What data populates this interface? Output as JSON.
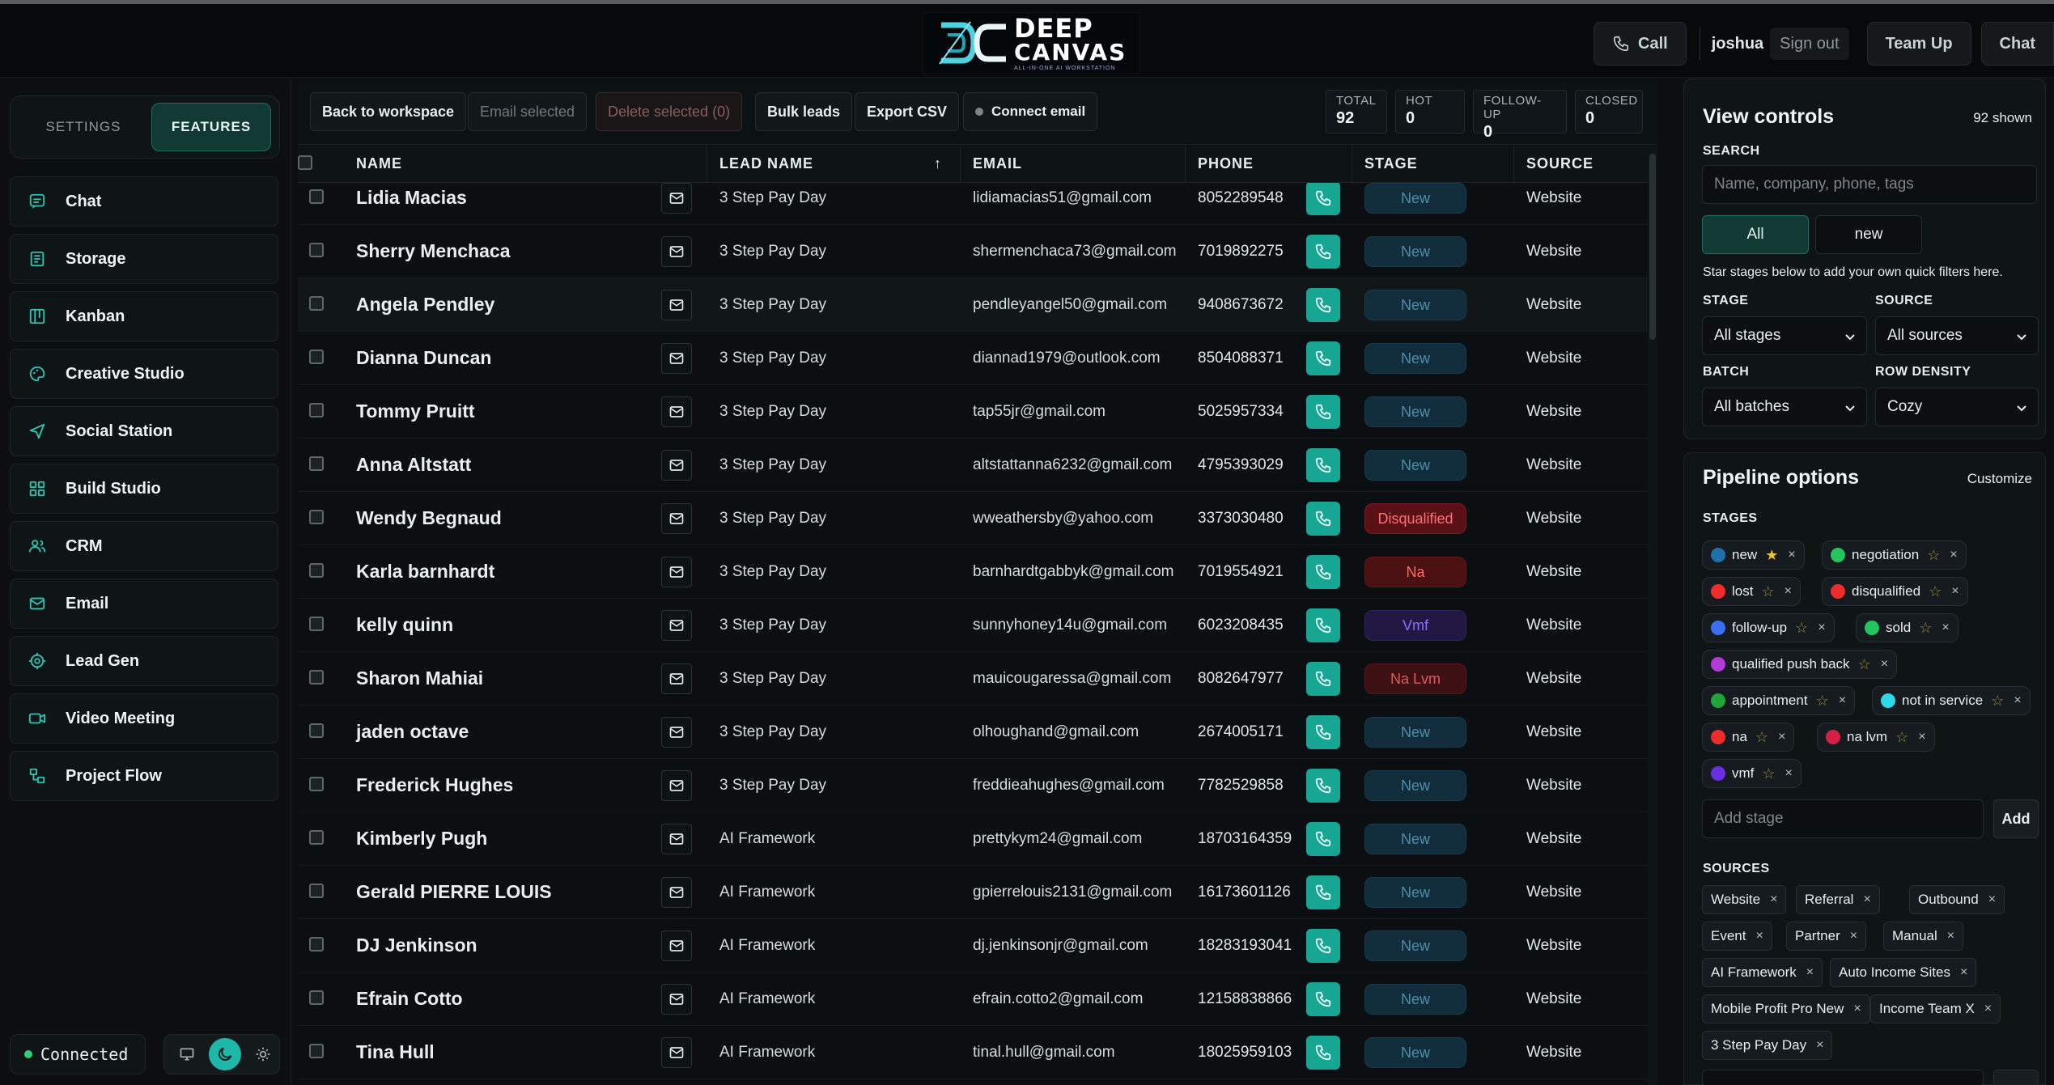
{
  "header": {
    "logo": {
      "line1": "DEEP",
      "line2": "CANVAS",
      "tagline": "ALL-IN-ONE AI WORKSTATION"
    },
    "call_label": "Call",
    "user": "joshua",
    "sign_out_label": "Sign out",
    "team_up_label": "Team Up",
    "chat_label": "Chat"
  },
  "sidebar": {
    "tabs": {
      "settings": "SETTINGS",
      "features": "FEATURES",
      "active": "features"
    },
    "items": [
      {
        "label": "Chat",
        "icon": "chat-icon"
      },
      {
        "label": "Storage",
        "icon": "storage-icon"
      },
      {
        "label": "Kanban",
        "icon": "kanban-icon"
      },
      {
        "label": "Creative Studio",
        "icon": "palette-icon"
      },
      {
        "label": "Social Station",
        "icon": "send-icon"
      },
      {
        "label": "Build Studio",
        "icon": "grid-icon"
      },
      {
        "label": "CRM",
        "icon": "users-icon"
      },
      {
        "label": "Email",
        "icon": "mail-icon"
      },
      {
        "label": "Lead Gen",
        "icon": "target-icon"
      },
      {
        "label": "Video Meeting",
        "icon": "video-icon"
      },
      {
        "label": "Project Flow",
        "icon": "flow-icon"
      }
    ],
    "status": "Connected",
    "theme_active": "dark"
  },
  "toolbar": {
    "back_label": "Back to workspace",
    "email_selected_label": "Email selected",
    "delete_selected_label": "Delete selected (0)",
    "bulk_leads_label": "Bulk leads",
    "export_csv_label": "Export CSV",
    "connect_email_label": "Connect email"
  },
  "stats": [
    {
      "label": "TOTAL",
      "value": "92"
    },
    {
      "label": "HOT",
      "value": "0"
    },
    {
      "label": "FOLLOW-UP",
      "value": "0"
    },
    {
      "label": "CLOSED",
      "value": "0"
    }
  ],
  "table": {
    "columns": {
      "name": "NAME",
      "lead_name": "LEAD NAME",
      "sort_indicator": "↑",
      "email": "EMAIL",
      "phone": "PHONE",
      "stage": "STAGE",
      "source": "SOURCE"
    },
    "rows": [
      {
        "name": "Lidia Macias",
        "lead": "3 Step Pay Day",
        "email": "lidiamacias51@gmail.com",
        "phone": "8052289548",
        "stage": "New",
        "stage_style": "new",
        "source": "Website"
      },
      {
        "name": "Sherry Menchaca",
        "lead": "3 Step Pay Day",
        "email": "shermenchaca73@gmail.com",
        "phone": "7019892275",
        "stage": "New",
        "stage_style": "new",
        "source": "Website"
      },
      {
        "name": "Angela Pendley",
        "lead": "3 Step Pay Day",
        "email": "pendleyangel50@gmail.com",
        "phone": "9408673672",
        "stage": "New",
        "stage_style": "new",
        "source": "Website"
      },
      {
        "name": "Dianna Duncan",
        "lead": "3 Step Pay Day",
        "email": "diannad1979@outlook.com",
        "phone": "8504088371",
        "stage": "New",
        "stage_style": "new",
        "source": "Website"
      },
      {
        "name": "Tommy Pruitt",
        "lead": "3 Step Pay Day",
        "email": "tap55jr@gmail.com",
        "phone": "5025957334",
        "stage": "New",
        "stage_style": "new",
        "source": "Website"
      },
      {
        "name": "Anna Altstatt",
        "lead": "3 Step Pay Day",
        "email": "altstattanna6232@gmail.com",
        "phone": "4795393029",
        "stage": "New",
        "stage_style": "new",
        "source": "Website"
      },
      {
        "name": "Wendy Begnaud",
        "lead": "3 Step Pay Day",
        "email": "wweathersby@yahoo.com",
        "phone": "3373030480",
        "stage": "Disqualified",
        "stage_style": "dis",
        "source": "Website"
      },
      {
        "name": "Karla barnhardt",
        "lead": "3 Step Pay Day",
        "email": "barnhardtgabbyk@gmail.com",
        "phone": "7019554921",
        "stage": "Na",
        "stage_style": "na",
        "source": "Website"
      },
      {
        "name": "kelly quinn",
        "lead": "3 Step Pay Day",
        "email": "sunnyhoney14u@gmail.com",
        "phone": "6023208435",
        "stage": "Vmf",
        "stage_style": "vmf",
        "source": "Website"
      },
      {
        "name": "Sharon Mahiai",
        "lead": "3 Step Pay Day",
        "email": "mauicougaressa@gmail.com",
        "phone": "8082647977",
        "stage": "Na Lvm",
        "stage_style": "nalvm",
        "source": "Website"
      },
      {
        "name": "jaden octave",
        "lead": "3 Step Pay Day",
        "email": "olhoughand@gmail.com",
        "phone": "2674005171",
        "stage": "New",
        "stage_style": "new",
        "source": "Website"
      },
      {
        "name": "Frederick Hughes",
        "lead": "3 Step Pay Day",
        "email": "freddieahughes@gmail.com",
        "phone": "7782529858",
        "stage": "New",
        "stage_style": "new",
        "source": "Website"
      },
      {
        "name": "Kimberly Pugh",
        "lead": "AI Framework",
        "email": "prettykym24@gmail.com",
        "phone": "18703164359",
        "stage": "New",
        "stage_style": "new",
        "source": "Website"
      },
      {
        "name": "Gerald PIERRE LOUIS",
        "lead": "AI Framework",
        "email": "gpierrelouis2131@gmail.com",
        "phone": "16173601126",
        "stage": "New",
        "stage_style": "new",
        "source": "Website"
      },
      {
        "name": "DJ Jenkinson",
        "lead": "AI Framework",
        "email": "dj.jenkinsonjr@gmail.com",
        "phone": "18283193041",
        "stage": "New",
        "stage_style": "new",
        "source": "Website"
      },
      {
        "name": "Efrain Cotto",
        "lead": "AI Framework",
        "email": "efrain.cotto2@gmail.com",
        "phone": "12158838866",
        "stage": "New",
        "stage_style": "new",
        "source": "Website"
      },
      {
        "name": "Tina Hull",
        "lead": "AI Framework",
        "email": "tinal.hull@gmail.com",
        "phone": "18025959103",
        "stage": "New",
        "stage_style": "new",
        "source": "Website"
      }
    ]
  },
  "view_controls": {
    "title": "View controls",
    "shown": "92 shown",
    "search_label": "SEARCH",
    "search_placeholder": "Name, company, phone, tags",
    "quick_filters": [
      "All",
      "new"
    ],
    "hint": "Star stages below to add your own quick filters here.",
    "stage_label": "STAGE",
    "stage_value": "All stages",
    "source_label": "SOURCE",
    "source_value": "All sources",
    "batch_label": "BATCH",
    "batch_value": "All batches",
    "density_label": "ROW DENSITY",
    "density_value": "Cozy"
  },
  "pipeline": {
    "title": "Pipeline options",
    "customize_label": "Customize",
    "stages_label": "STAGES",
    "stages": [
      {
        "label": "new",
        "color": "#1f6fa8",
        "starred": true
      },
      {
        "label": "negotiation",
        "color": "#22c55e",
        "starred": false
      },
      {
        "label": "lost",
        "color": "#ef2b2b",
        "starred": false
      },
      {
        "label": "disqualified",
        "color": "#ef2b2b",
        "starred": false
      },
      {
        "label": "follow-up",
        "color": "#3b6ff5",
        "starred": false
      },
      {
        "label": "sold",
        "color": "#22c55e",
        "starred": false
      },
      {
        "label": "qualified push back",
        "color": "#b23ad6",
        "starred": false
      },
      {
        "label": "appointment",
        "color": "#1fa53a",
        "starred": false
      },
      {
        "label": "not in service",
        "color": "#2bd9e8",
        "starred": false
      },
      {
        "label": "na",
        "color": "#ef2b2b",
        "starred": false
      },
      {
        "label": "na lvm",
        "color": "#d61f45",
        "starred": false
      },
      {
        "label": "vmf",
        "color": "#6a2fe0",
        "starred": false
      }
    ],
    "add_stage_placeholder": "Add stage",
    "add_label": "Add",
    "sources_label": "SOURCES",
    "sources": [
      "Website",
      "Referral",
      "Outbound",
      "Event",
      "Partner",
      "Manual",
      "AI Framework",
      "Auto Income Sites",
      "Mobile Profit Pro New",
      "Income Team X",
      "3 Step Pay Day"
    ],
    "close_glyph": "×",
    "star_glyph": "☆",
    "star_on_glyph": "★"
  }
}
